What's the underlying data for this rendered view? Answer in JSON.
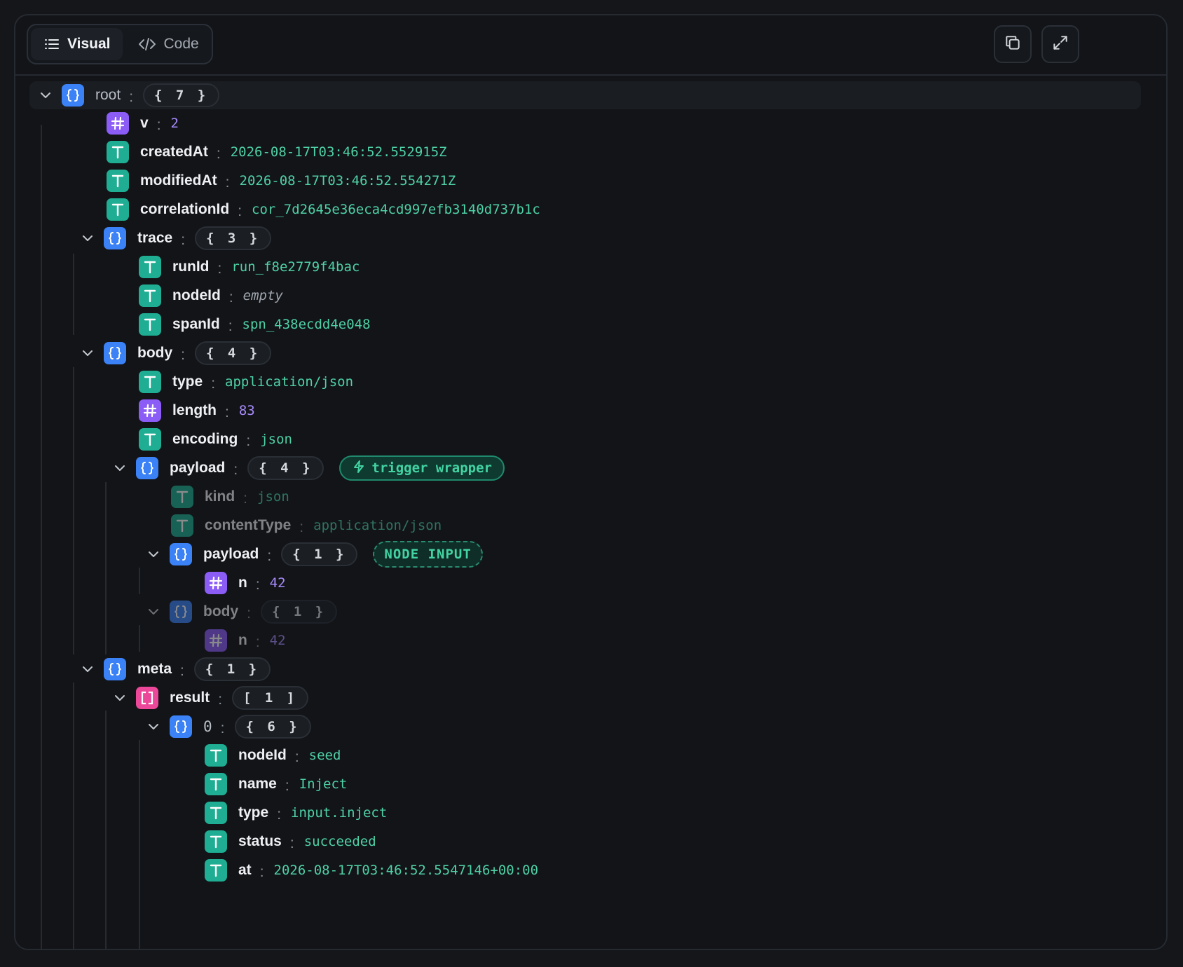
{
  "toolbar": {
    "tab_visual": "Visual",
    "tab_code": "Code",
    "active_tab": "Visual",
    "copy_icon": "copy-icon",
    "expand_icon": "expand-icon"
  },
  "colors": {
    "string_type": "#1fae93",
    "number_type": "#8b5cf6",
    "object_type": "#3b82f6",
    "array_type": "#ec4899",
    "string_value": "#4fd1a5",
    "number_value": "#a78bfa"
  },
  "tree": {
    "root": {
      "key": "root",
      "count": "{ 7 }"
    },
    "v": {
      "key": "v",
      "value": "2"
    },
    "createdAt": {
      "key": "createdAt",
      "value": "2026-08-17T03:46:52.552915Z"
    },
    "modifiedAt": {
      "key": "modifiedAt",
      "value": "2026-08-17T03:46:52.554271Z"
    },
    "correlationId": {
      "key": "correlationId",
      "value": "cor_7d2645e36eca4cd997efb3140d737b1c"
    },
    "trace": {
      "key": "trace",
      "count": "{ 3 }",
      "runId": {
        "key": "runId",
        "value": "run_f8e2779f4bac"
      },
      "nodeId": {
        "key": "nodeId",
        "value": "empty"
      },
      "spanId": {
        "key": "spanId",
        "value": "spn_438ecdd4e048"
      }
    },
    "body": {
      "key": "body",
      "count": "{ 4 }",
      "type": {
        "key": "type",
        "value": "application/json"
      },
      "length": {
        "key": "length",
        "value": "83"
      },
      "encoding": {
        "key": "encoding",
        "value": "json"
      },
      "payload": {
        "key": "payload",
        "count": "{ 4 }",
        "badge": "trigger wrapper",
        "kind": {
          "key": "kind",
          "value": "json"
        },
        "contentType": {
          "key": "contentType",
          "value": "application/json"
        },
        "payload": {
          "key": "payload",
          "count": "{ 1 }",
          "badge": "NODE INPUT",
          "n": {
            "key": "n",
            "value": "42"
          }
        },
        "body": {
          "key": "body",
          "count": "{ 1 }",
          "n": {
            "key": "n",
            "value": "42"
          }
        }
      }
    },
    "meta": {
      "key": "meta",
      "count": "{ 1 }",
      "result": {
        "key": "result",
        "count": "[ 1 ]",
        "item0": {
          "key": "0",
          "count": "{ 6 }",
          "nodeId": {
            "key": "nodeId",
            "value": "seed"
          },
          "name": {
            "key": "name",
            "value": "Inject"
          },
          "type": {
            "key": "type",
            "value": "input.inject"
          },
          "status": {
            "key": "status",
            "value": "succeeded"
          },
          "at": {
            "key": "at",
            "value": "2026-08-17T03:46:52.5547146+00:00"
          }
        }
      }
    }
  }
}
